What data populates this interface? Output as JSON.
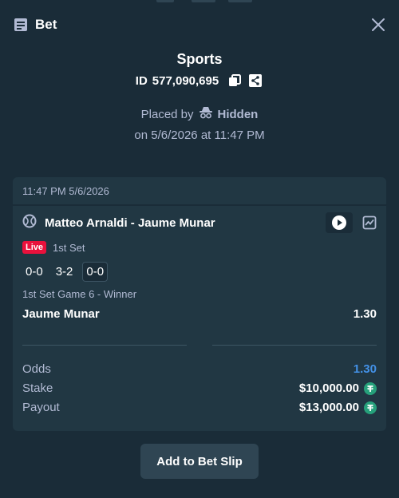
{
  "header": {
    "title": "Bet",
    "icon": "receipt-icon",
    "close_icon": "close-icon"
  },
  "bet": {
    "category": "Sports",
    "id_prefix": "ID",
    "id_number": "577,090,695",
    "placed_by_label": "Placed by",
    "placed_by_user": "Hidden",
    "placed_on": "on 5/6/2026 at 11:47 PM"
  },
  "card": {
    "timestamp": "11:47 PM 5/6/2026",
    "match_title": "Matteo Arnaldi - Jaume Munar",
    "sport_icon": "tennis-icon",
    "live_label": "Live",
    "period": "1st Set",
    "scores": [
      "0-0",
      "3-2",
      "0-0"
    ],
    "market": "1st Set Game 6 - Winner",
    "selection": "Jaume Munar",
    "selection_odds": "1.30"
  },
  "summary": {
    "odds_label": "Odds",
    "odds_value": "1.30",
    "stake_label": "Stake",
    "stake_value": "$10,000.00",
    "payout_label": "Payout",
    "payout_value": "$13,000.00",
    "currency_icon": "tether-icon"
  },
  "footer": {
    "add_button": "Add to Bet Slip"
  },
  "colors": {
    "background": "#1a2c38",
    "card": "#213743",
    "live": "#e9113c",
    "odds_accent": "#4391e7",
    "tether": "#26a17b"
  }
}
